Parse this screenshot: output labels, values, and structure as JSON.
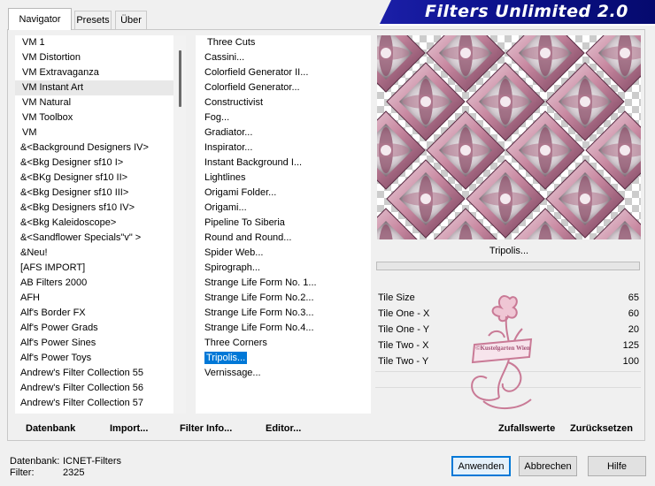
{
  "tabs": [
    "Navigator",
    "Presets",
    "Über"
  ],
  "banner_title": "Filters Unlimited 2.0",
  "categories": [
    "VM 1",
    "VM Distortion",
    "VM Extravaganza",
    "VM Instant Art",
    "VM Natural",
    "VM Toolbox",
    "VM",
    "&<Background Designers IV>",
    "&<Bkg Designer sf10 I>",
    "&<BKg Designer sf10 II>",
    "&<Bkg Designer sf10 III>",
    "&<Bkg Designers sf10 IV>",
    "&<Bkg Kaleidoscope>",
    "&<Sandflower Specials\"v\" >",
    "&Neu!",
    "[AFS IMPORT]",
    "AB Filters 2000",
    "AFH",
    "Alf's Border FX",
    "Alf's Power Grads",
    "Alf's Power Sines",
    "Alf's Power Toys",
    "Andrew's Filter Collection 55",
    "Andrew's Filter Collection 56",
    "Andrew's Filter Collection 57"
  ],
  "category_selected_index": 3,
  "filters": [
    "Three Cuts",
    "Cassini...",
    "Colorfield Generator II...",
    "Colorfield Generator...",
    "Constructivist",
    "Fog...",
    "Gradiator...",
    "Inspirator...",
    "Instant Background I...",
    "Lightlines",
    "Origami Folder...",
    "Origami...",
    "Pipeline To Siberia",
    "Round and Round...",
    "Spider Web...",
    "Spirograph...",
    "Strange Life Form No. 1...",
    "Strange Life Form No.2...",
    "Strange Life Form No.3...",
    "Strange Life Form No.4...",
    "Three Corners",
    "Tripolis...",
    "Vernissage..."
  ],
  "filter_selected_index": 21,
  "filter_name": "Tripolis...",
  "params": [
    {
      "label": "Tile Size",
      "value": "65"
    },
    {
      "label": "Tile One - X",
      "value": "60"
    },
    {
      "label": "Tile One - Y",
      "value": "20"
    },
    {
      "label": "Tile Two - X",
      "value": "125"
    },
    {
      "label": "Tile Two - Y",
      "value": "100"
    }
  ],
  "watermark_text": "©Kustelgarten Wien",
  "toolbar": {
    "datenbank": "Datenbank",
    "import": "Import...",
    "filter_info": "Filter Info...",
    "editor": "Editor...",
    "zufallswerte": "Zufallswerte",
    "zuruecksetzen": "Zurücksetzen"
  },
  "status": {
    "db_label": "Datenbank:",
    "db_value": "ICNET-Filters",
    "filter_label": "Filter:",
    "filter_value": "2325"
  },
  "buttons": {
    "apply": "Anwenden",
    "cancel": "Abbrechen",
    "help": "Hilfe"
  },
  "colors": {
    "banner": "#0d128e",
    "selection": "#0078d7",
    "preview_pink": "#c98aa2",
    "preview_plum": "#7a3f57"
  }
}
